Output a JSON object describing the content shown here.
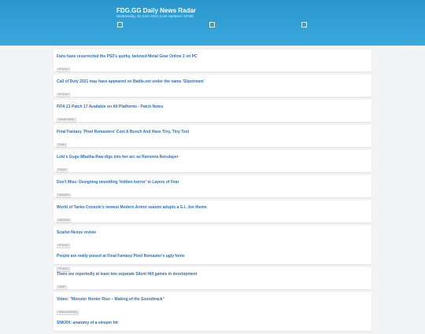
{
  "header": {
    "title": "FDG.GG Daily News Radar",
    "subtitle": "Wednesday, 30 June 2021 (Last Updated: 23:59)"
  },
  "feed": [
    {
      "title": "Fans have resurrected the PS3's quirky, beloved Metal Gear Online 2 on PC",
      "source": "PC Gamer"
    },
    {
      "title": "Call of Duty 2021 may have appeared on Battle.net under the name 'Slipstream'",
      "source": "PC Gamer"
    },
    {
      "title": "FIFA 21 Patch 17 Available on All Platforms - Patch Notes",
      "source": "Operation Sports"
    },
    {
      "title": "Final Fantasy 'Pixel Remasters' Cost A Bunch And Have Tiny, Tiny Text",
      "source": "Kotaku"
    },
    {
      "title": "Loki's Gugu Mbatha-Raw digs into her arc as Ravonna Renslayer",
      "source": "Polygon"
    },
    {
      "title": "Don't Miss: Designing unsettling 'hidden horror' in Layers of Fear",
      "source": "Gamasutra"
    },
    {
      "title": "World of Tanks Console's newest Modern Armor season adopts a G.I. Joe theme",
      "source": "Destructoid"
    },
    {
      "title": "Scarlet Nexus review",
      "source": "PC Gamer"
    },
    {
      "title": "People are really pissed at Final Fantasy Pixel Remaster's ugly fonts",
      "source": "PC Gamer"
    },
    {
      "title": "There are reportedly at least two separate Silent Hill games in development",
      "source": "VG247"
    },
    {
      "title": "Video: \"Monster Hunter Rise – Making of the Soundtrack\"",
      "source": "Nintendo Everything"
    },
    {
      "title": "SNKRX: anatomy of a sleeper hit",
      "source": ""
    }
  ]
}
